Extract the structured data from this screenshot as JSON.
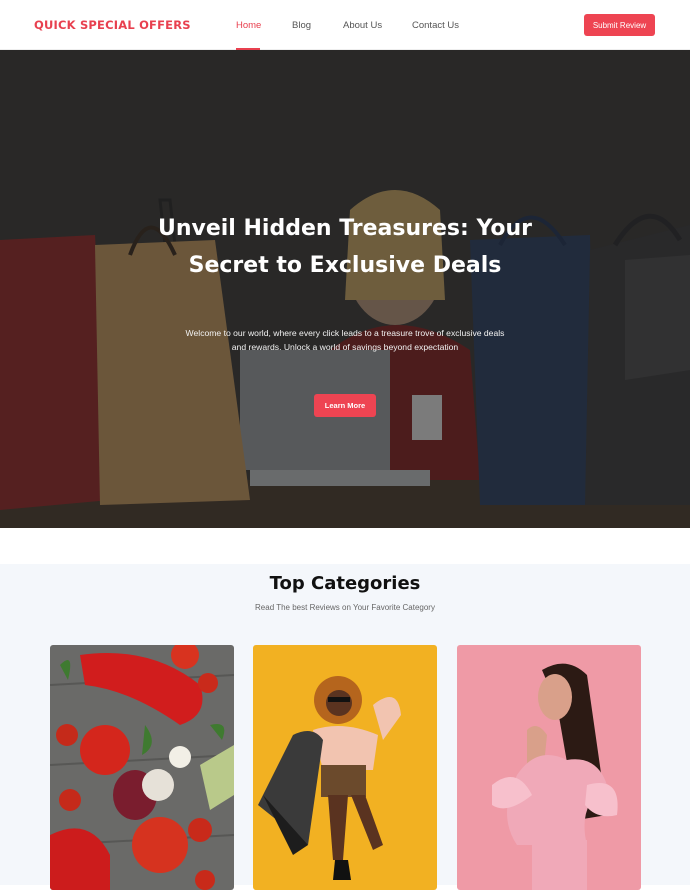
{
  "nav": {
    "brand": "QUICK SPECIAL OFFERS",
    "links": [
      "Home",
      "Blog",
      "About Us",
      "Contact Us"
    ],
    "active_link": "Home",
    "cta": "Submit Review"
  },
  "hero": {
    "title": "Unveil Hidden Treasures: Your Secret to Exclusive Deals",
    "text": "Welcome to our world, where every click leads to a treasure trove of exclusive deals and rewards. Unlock a world of savings beyond expectation",
    "button": "Learn More"
  },
  "categories": {
    "title": "Top Categories",
    "subtitle": "Read The best Reviews on Your Favorite Category"
  },
  "colors": {
    "accent": "#ee4452",
    "brand": "#e8404f",
    "section_bg": "#f4f7fb"
  }
}
